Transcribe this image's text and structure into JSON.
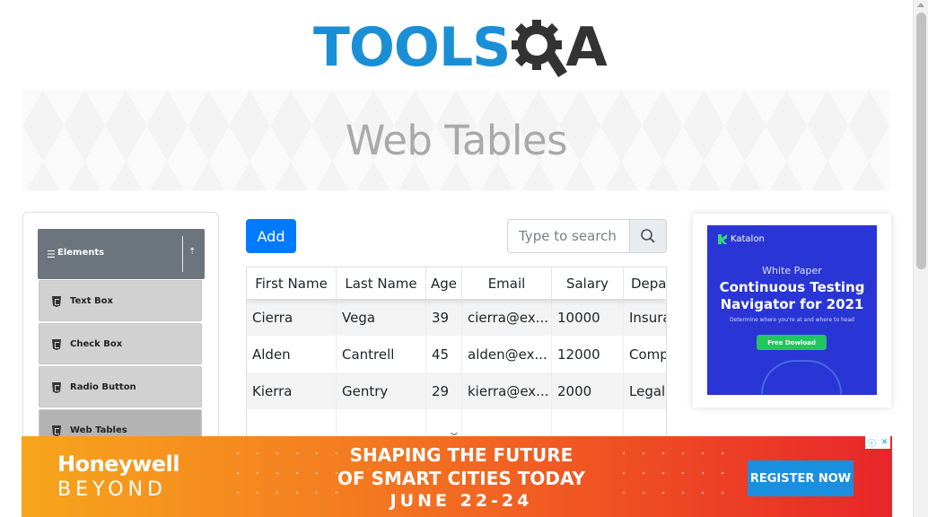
{
  "header": {
    "logo_tools": "TOOLS",
    "logo_qa": "QA",
    "page_title": "Web Tables"
  },
  "sidebar": {
    "group_title": "Elements",
    "items": [
      {
        "label": "Text Box"
      },
      {
        "label": "Check Box"
      },
      {
        "label": "Radio Button"
      },
      {
        "label": "Web Tables"
      }
    ]
  },
  "toolbar": {
    "add_label": "Add",
    "search_placeholder": "Type to search"
  },
  "table": {
    "columns": [
      "First Name",
      "Last Name",
      "Age",
      "Email",
      "Salary",
      "Depar"
    ],
    "rows": [
      [
        "Cierra",
        "Vega",
        "39",
        "cierra@ex...",
        "10000",
        "Insura"
      ],
      [
        "Alden",
        "Cantrell",
        "45",
        "alden@ex...",
        "12000",
        "Comp"
      ],
      [
        "Kierra",
        "Gentry",
        "29",
        "kierra@ex...",
        "2000",
        "Legal"
      ]
    ]
  },
  "side_ad": {
    "brand": "Katalon",
    "kicker": "White Paper",
    "headline_1": "Continuous Testing",
    "headline_2": "Navigator for 2021",
    "sub": "Determine where you're at and where to head",
    "cta": "Free Dowload",
    "bg_color": "#2a35d6"
  },
  "bottom_ad": {
    "brand": "Honeywell",
    "brand_sub": "BEYOND",
    "line1": "SHAPING THE FUTURE",
    "line2": "OF SMART CITIES TODAY",
    "line3": "JUNE 22-24",
    "cta": "REGISTER NOW"
  },
  "colors": {
    "accent_blue": "#007bff",
    "logo_blue": "#1b8fd6",
    "sidebar_header": "#6c757d"
  }
}
